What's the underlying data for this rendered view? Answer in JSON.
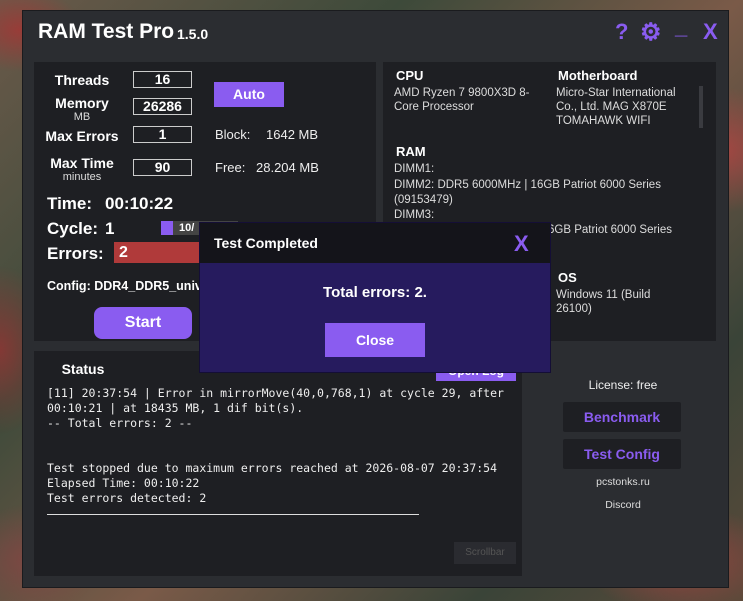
{
  "app": {
    "title": "RAM Test Pro",
    "version": "1.5.0"
  },
  "titlebar": {
    "help": "?",
    "settings": "⚙",
    "minimize": "_",
    "close": "X"
  },
  "settings": {
    "threads_label": "Threads",
    "threads_value": "16",
    "memory_label": "Memory",
    "memory_unit": "MB",
    "memory_value": "26286",
    "max_errors_label": "Max Errors",
    "max_errors_value": "1",
    "max_time_label": "Max Time",
    "max_time_unit": "minutes",
    "max_time_value": "90",
    "auto_button": "Auto",
    "block_label": "Block:",
    "block_value": "1642 MB",
    "free_label": "Free:",
    "free_value": "28.204 MB"
  },
  "progress": {
    "time_label": "Time:",
    "time_value": "00:10:22",
    "cycle_label": "Cycle:",
    "cycle_value": "1",
    "cycle_bar_text": "10/",
    "errors_label": "Errors:",
    "errors_value": "2",
    "config_text": "Config: DDR4_DDR5_unive"
  },
  "start_button": "Start",
  "sysinfo": {
    "cpu_title": "CPU",
    "cpu_value": "AMD Ryzen 7 9800X3D 8-Core Processor",
    "mb_title": "Motherboard",
    "mb_value": "Micro-Star International Co., Ltd. MAG X870E TOMAHAWK WIFI",
    "ram_title": "RAM",
    "dimm1": "DIMM1:",
    "dimm2": "DIMM2: DDR5 6000MHz | 16GB Patriot 6000 Series",
    "dimm2_serial": "(09153479)",
    "dimm3": "DIMM3:",
    "dimm4_partial": "6GB Patriot 6000 Series",
    "os_title": "OS",
    "os_value": "Windows 11 (Build 26100)"
  },
  "status": {
    "title": "Status",
    "open_log": "Open Log",
    "log": [
      "[11] 20:37:54 | Error in mirrorMove(40,0,768,1) at cycle 29, after",
      "00:10:21 | at 18435 MB, 1 dif bit(s).",
      "-- Total errors: 2 --",
      "",
      "",
      "Test stopped due to maximum errors reached at 2026-08-07 20:37:54",
      "Elapsed Time: 00:10:22",
      "Test errors detected: 2"
    ],
    "scrollbar": "Scrollbar"
  },
  "side": {
    "license": "License: free",
    "benchmark": "Benchmark",
    "test_config": "Test Config",
    "site": "pcstonks.ru",
    "discord": "Discord"
  },
  "modal": {
    "title": "Test Completed",
    "close_x": "X",
    "message": "Total errors: 2.",
    "close_button": "Close"
  },
  "colors": {
    "accent": "#8a5cf0",
    "window_bg": "#2b2d31",
    "panel_bg": "#1e1f23",
    "error_red": "#b03a3a",
    "modal_bg": "#261b5e"
  }
}
